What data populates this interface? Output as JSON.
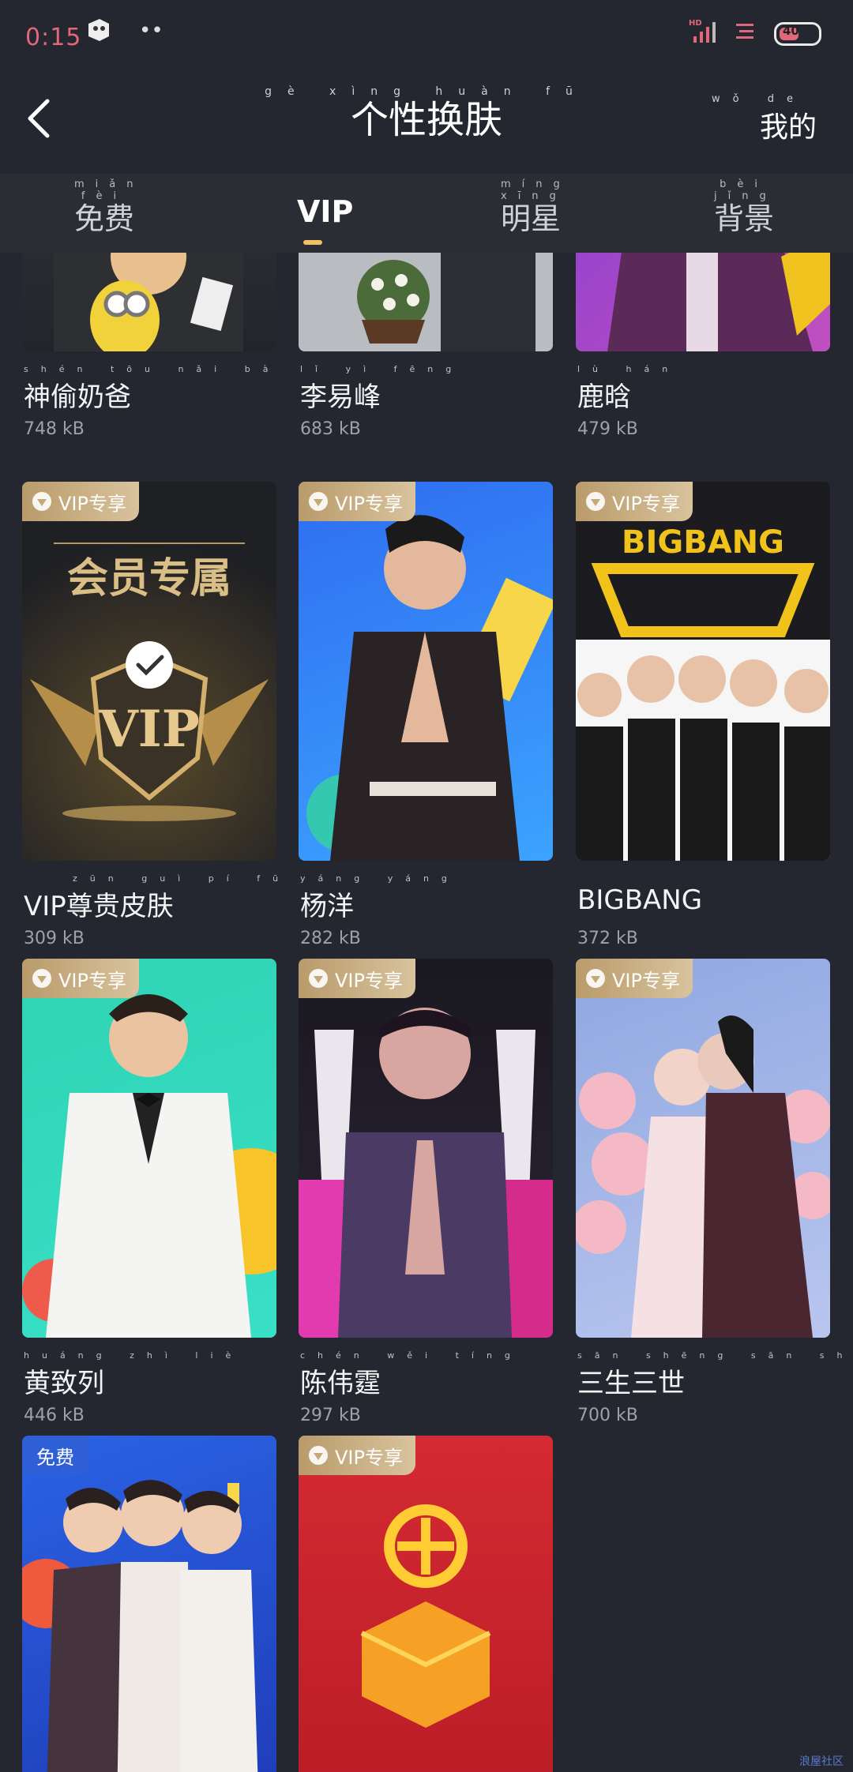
{
  "status_bar": {
    "time": "0:15",
    "battery": "40",
    "dots": "••"
  },
  "header": {
    "title": "个性换肤",
    "title_pinyin": "gè xìng huàn fū",
    "mine_label": "我的",
    "mine_pinyin": "wǒ de"
  },
  "tabs": [
    {
      "label": "免费",
      "pinyin": "miǎn fèi"
    },
    {
      "label": "VIP",
      "pinyin": ""
    },
    {
      "label": "明星",
      "pinyin": "míng xīng"
    },
    {
      "label": "背景",
      "pinyin": "bèi jǐng"
    }
  ],
  "skins": [
    {
      "name": "神偷奶爸",
      "pinyin": "shén tōu nǎi bà",
      "size": "748 kB",
      "badge": ""
    },
    {
      "name": "李易峰",
      "pinyin": "lǐ yì fēng",
      "size": "683 kB",
      "badge": ""
    },
    {
      "name": "鹿晗",
      "pinyin": "lù hán",
      "size": "479 kB",
      "badge": ""
    },
    {
      "name": "VIP尊贵皮肤",
      "pinyin": "zūn guì pí fū",
      "size": "309 kB",
      "badge": "VIP专享"
    },
    {
      "name": "杨洋",
      "pinyin": "yáng yáng",
      "size": "282 kB",
      "badge": "VIP专享"
    },
    {
      "name": "BIGBANG",
      "pinyin": "",
      "size": "372 kB",
      "badge": "VIP专享"
    },
    {
      "name": "黄致列",
      "pinyin": "huáng zhì liè",
      "size": "446 kB",
      "badge": "VIP专享"
    },
    {
      "name": "陈伟霆",
      "pinyin": "chén wěi tíng",
      "size": "297 kB",
      "badge": "VIP专享"
    },
    {
      "name": "三生三世",
      "pinyin": "sān shēng sān shì",
      "size": "700 kB",
      "badge": "VIP专享"
    },
    {
      "name": "",
      "pinyin": "",
      "size": "",
      "badge": "免费"
    },
    {
      "name": "",
      "pinyin": "",
      "size": "",
      "badge": "VIP专享"
    }
  ],
  "poster_text": {
    "vip_member": "会员专属",
    "vip_shield": "VIP",
    "bigbang_logo": "BIGBANG"
  },
  "watermark": "浪屋社区"
}
